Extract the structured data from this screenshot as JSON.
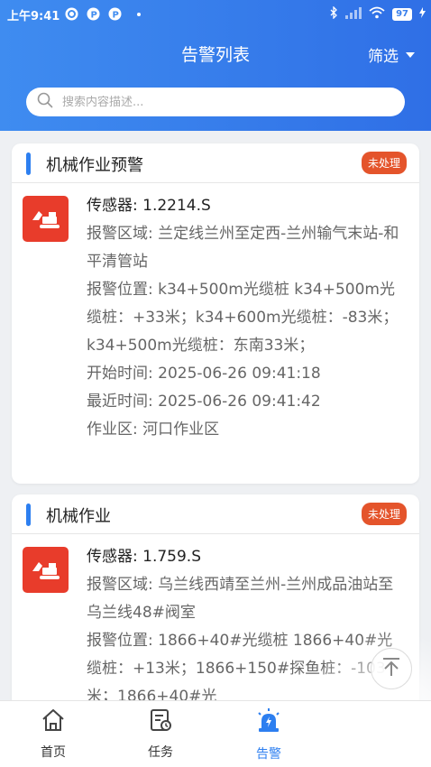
{
  "status_bar": {
    "time": "上午9:41",
    "battery": "97"
  },
  "header": {
    "title": "告警列表",
    "filter_label": "筛选"
  },
  "search": {
    "placeholder": "搜索内容描述..."
  },
  "alarms": [
    {
      "title": "机械作业预警",
      "status": "未处理",
      "sensor": "传感器: 1.2214.S",
      "area": "报警区域: 兰定线兰州至定西-兰州输气末站-和平清管站",
      "position": "报警位置: k34+500m光缆桩 k34+500m光缆桩：+33米；k34+600m光缆桩：-83米；k34+500m光缆桩：东南33米；",
      "start_time": "开始时间: 2025-06-26 09:41:18",
      "recent_time": "最近时间: 2025-06-26 09:41:42",
      "work_zone": "作业区: 河口作业区"
    },
    {
      "title": "机械作业",
      "status": "未处理",
      "sensor": "传感器: 1.759.S",
      "area": "报警区域: 乌兰线西靖至兰州-兰州成品油站至乌兰线48#阀室",
      "position": "报警位置: 1866+40#光缆桩 1866+40#光缆桩：+13米；1866+150#探鱼桩：-103米；1866+40#光"
    }
  ],
  "tabs": [
    {
      "label": "首页",
      "icon": "home-icon",
      "active": false
    },
    {
      "label": "任务",
      "icon": "task-icon",
      "active": false
    },
    {
      "label": "告警",
      "icon": "alarm-icon",
      "active": true
    }
  ],
  "colors": {
    "primary": "#2d7ff0",
    "badge": "#e4542b",
    "alarm_icon_bg": "#e83c2b"
  }
}
